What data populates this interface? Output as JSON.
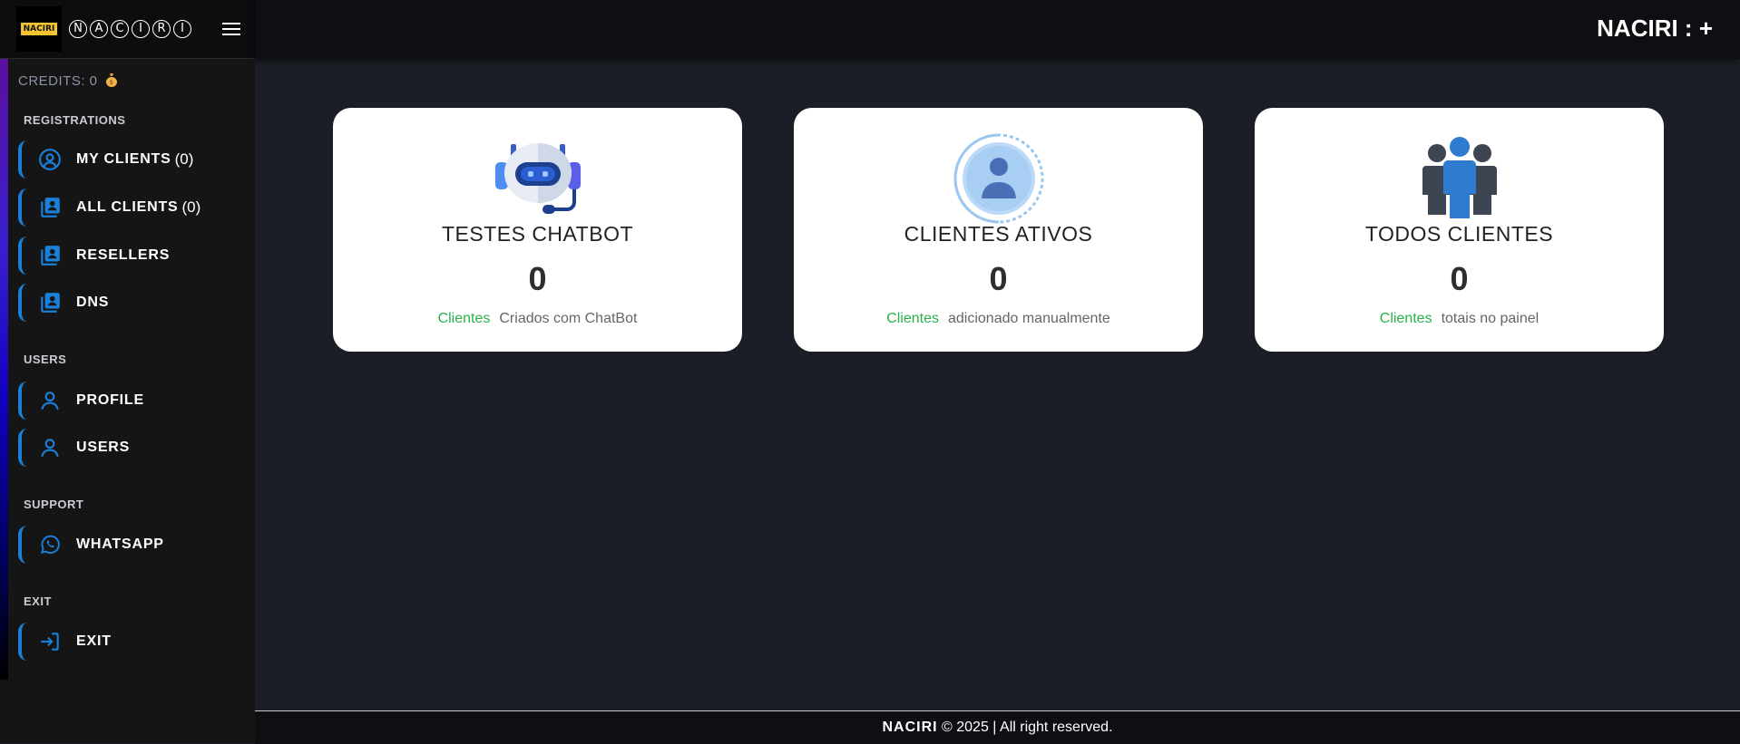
{
  "brand": {
    "logo_text": "NACIRI",
    "letters": [
      "N",
      "A",
      "C",
      "I",
      "R",
      "I"
    ]
  },
  "credits": {
    "label": "CREDITS: 0"
  },
  "sections": {
    "registrations": "REGISTRATIONS",
    "users": "USERS",
    "support": "SUPPORT",
    "exit": "EXIT"
  },
  "nav": {
    "my_clients": {
      "label": "MY CLIENTS",
      "count": "(0)"
    },
    "all_clients": {
      "label": "ALL CLIENTS",
      "count": "(0)"
    },
    "resellers": {
      "label": "RESELLERS"
    },
    "dns": {
      "label": "DNS"
    },
    "profile": {
      "label": "PROFILE"
    },
    "users": {
      "label": "USERS"
    },
    "whatsapp": {
      "label": "WHATSAPP"
    },
    "exit": {
      "label": "EXIT"
    }
  },
  "header": {
    "title": "NACIRI : +"
  },
  "cards": [
    {
      "icon": "robot-icon",
      "title": "TESTES CHATBOT",
      "value": "0",
      "sub_green": "Clientes",
      "sub_text": "Criados com ChatBot"
    },
    {
      "icon": "user-circle-icon",
      "title": "CLIENTES ATIVOS",
      "value": "0",
      "sub_green": "Clientes",
      "sub_text": "adicionado manualmente"
    },
    {
      "icon": "group-icon",
      "title": "TODOS CLIENTES",
      "value": "0",
      "sub_green": "Clientes",
      "sub_text": "totais no painel"
    }
  ],
  "footer": {
    "brand": "NACIRI",
    "text": " © 2025 | All right reserved."
  },
  "colors": {
    "accent": "#1a7fd8",
    "green": "#2ab24a",
    "bg": "#1b1e26"
  }
}
